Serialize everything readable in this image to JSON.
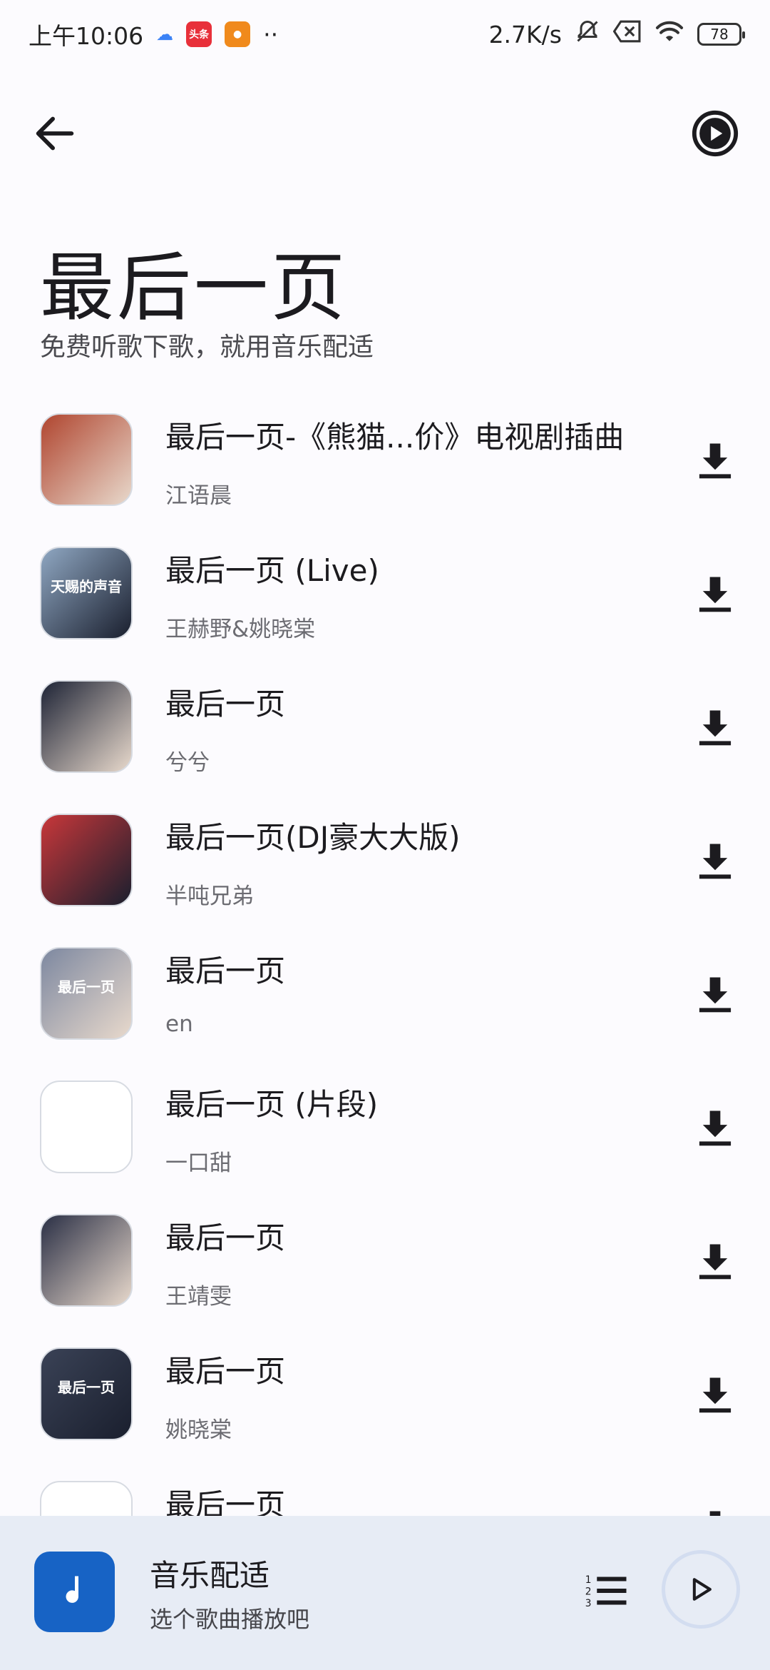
{
  "status_bar": {
    "time": "上午10:06",
    "badge_toutiao": "头条",
    "more": "··",
    "net_speed": "2.7K/s",
    "battery": "78"
  },
  "page": {
    "title": "最后一页",
    "subtitle": "免费听歌下歌，就用音乐配适"
  },
  "songs": [
    {
      "title": "最后一页-《熊猫...价》电视剧插曲",
      "artist": "江语晨",
      "cover_color": "#b0452f"
    },
    {
      "title": "最后一页 (Live)",
      "artist": "王赫野&姚晓棠",
      "cover_color": "#8fa7c2",
      "cover_text": "天赐的声音"
    },
    {
      "title": "最后一页",
      "artist": "兮兮",
      "cover_color": "#1e2436"
    },
    {
      "title": "最后一页(DJ豪大大版)",
      "artist": "半吨兄弟",
      "cover_color": "#c8373a"
    },
    {
      "title": "最后一页",
      "artist": "en",
      "cover_color": "#7d88a0",
      "cover_text": "最后一页"
    },
    {
      "title": "最后一页 (片段)",
      "artist": "一口甜",
      "cover_color": "#ffffff"
    },
    {
      "title": "最后一页",
      "artist": "王靖雯",
      "cover_color": "#2a2f45"
    },
    {
      "title": "最后一页",
      "artist": "姚晓棠",
      "cover_color": "#3a4256",
      "cover_text": "最后一页"
    },
    {
      "title": "最后一页",
      "artist": "",
      "cover_color": "#ffffff"
    }
  ],
  "player": {
    "title": "音乐配适",
    "subtitle": "选个歌曲播放吧"
  },
  "colors": {
    "accent": "#1763c5",
    "player_bg": "#e7ecf5",
    "background": "#fcfbfe"
  }
}
